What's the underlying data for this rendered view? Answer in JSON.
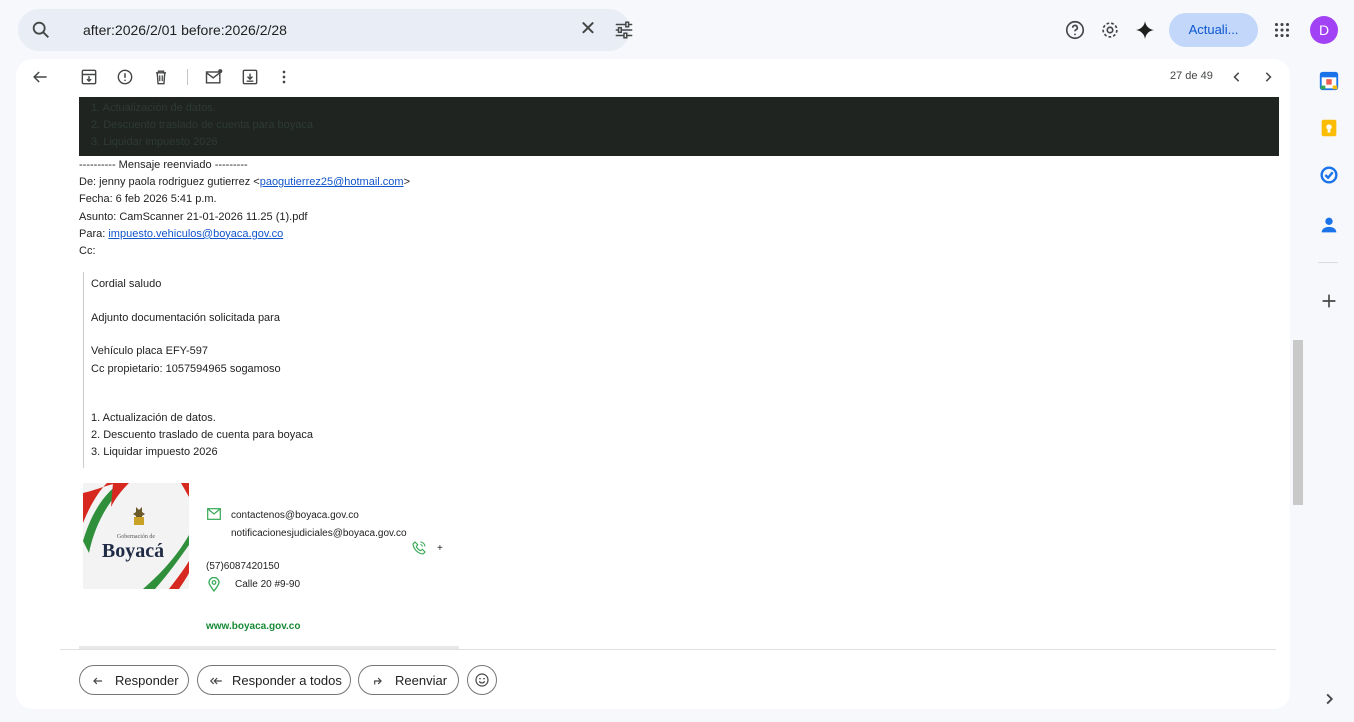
{
  "search": {
    "query": "after:2026/2/01 before:2026/2/28"
  },
  "header": {
    "update_label": "Actuali...",
    "avatar_letter": "D"
  },
  "toolbar": {
    "pager": "27 de 49"
  },
  "hidden_block": {
    "lines": [
      "1. Actualización de datos.",
      "2. Descuento traslado de cuenta para boyaca",
      "3. Liquidar impuesto 2026"
    ]
  },
  "forward": {
    "separator": "---------- Mensaje reenviado ---------",
    "from_prefix": "De: jenny paola rodriguez gutierrez <",
    "from_email": "paogutierrez25@hotmail.com",
    "from_suffix": ">",
    "date": "Fecha: 6 feb 2026 5:41 p.m.",
    "subject": "Asunto: CamScanner 21-01-2026 11.25 (1).pdf",
    "to_prefix": "Para: ",
    "to_email": "impuesto.vehiculos@boyaca.gov.co",
    "cc": "Cc:"
  },
  "body": {
    "greeting": "Cordial saludo",
    "intro": "Adjunto documentación solicitada para",
    "vehicle": "Vehículo  placa EFY-597",
    "owner": "Cc propietario: 1057594965 sogamoso",
    "items": [
      "1. Actualización de datos.",
      "2. Descuento traslado de cuenta para boyaca",
      "3. Liquidar impuesto 2026"
    ]
  },
  "signature": {
    "logo_small": "Gobernación de",
    "logo_name": "Boyacá",
    "email1": "contactenos@boyaca.gov.co",
    "email2": "notificacionesjudiciales@boyaca.gov.co",
    "phone_plus": "+",
    "phone": "(57)6087420150",
    "address": "Calle 20 #9-90",
    "web": "www.boyaca.gov.co"
  },
  "actions": {
    "reply": "Responder",
    "reply_all": "Responder a todos",
    "forward": "Reenviar"
  },
  "colors": {
    "accent": "#0b57d0",
    "update_bg": "#c2d7fa",
    "avatar": "#a142f4",
    "signature_green": "#178a34",
    "logo_red": "#d6281f"
  }
}
